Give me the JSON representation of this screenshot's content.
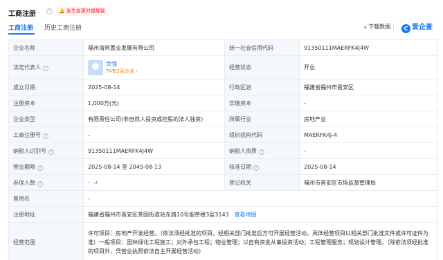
{
  "header": {
    "title": "工商注册",
    "alert": "发生变更时提醒我",
    "tabs": [
      "工商注册",
      "历史工商注册"
    ],
    "download": "下载数据",
    "logo": "爱企查"
  },
  "rows": [
    {
      "l1": "企业名称",
      "v1": "福州海筑置业发展有限公司",
      "l2": "统一社会信用代码",
      "v2": "91350111MAERFK4J4W"
    },
    {
      "l1": "法定代表人",
      "v1": "",
      "l2": "经营状态",
      "v2": "开业"
    },
    {
      "l1": "成立日期",
      "v1": "2025-08-14",
      "l2": "行政区划",
      "v2": "福建省福州市晋安区"
    },
    {
      "l1": "注册资本",
      "v1": "1,000万(元)",
      "l2": "实缴资本",
      "v2": "-"
    },
    {
      "l1": "企业类型",
      "v1": "有限责任公司(非自然人投资或控股的法人独资)",
      "l2": "所属行业",
      "v2": "房地产业"
    },
    {
      "l1": "工商注册号",
      "v1": "-",
      "l2": "组织机构代码",
      "v2": "MAERFK4J-4"
    },
    {
      "l1": "纳税人识别号",
      "v1": "91350111MAERFK4J4W",
      "l2": "纳税人资质",
      "v2": "-"
    },
    {
      "l1": "营业期限",
      "v1": "2025-08-14 至 2045-08-13",
      "l2": "核准日期",
      "v2": "2025-08-14"
    },
    {
      "l1": "参保人数",
      "v1": "-",
      "l2": "登记机关",
      "v2": "福州市晋安区市场监督管理局"
    },
    {
      "l1": "曾用名",
      "v1": "-"
    },
    {
      "l1": "注册地址",
      "v1": "福建省福州市晋安区茶园街道站东路10号烟草楼3层3143",
      "link": "查看地图"
    },
    {
      "l1": "经营范围",
      "v1": "许可项目：房地产开发经营。（依法须经批准的项目，经相关部门批准后方可开展经营活动，具体经营项目以相关部门批准文件或许可证件为准）一般项目：园林绿化工程施工；对外承包工程；物业管理；以自有资金从事投资活动；工程管理服务；规划设计管理。（除依法须经批准的项目外，凭营业执照依法自主开展经营活动）"
    }
  ],
  "legal_rep": {
    "name": "余强",
    "sub": "TA有2家企业 ›"
  }
}
